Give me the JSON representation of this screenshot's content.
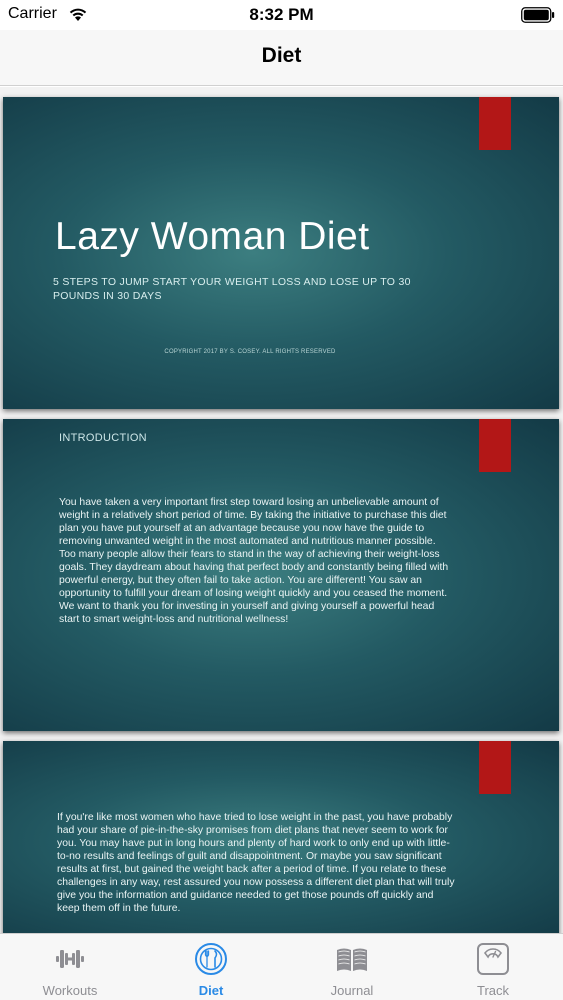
{
  "status_bar": {
    "carrier": "Carrier",
    "time": "8:32 PM"
  },
  "nav": {
    "title": "Diet"
  },
  "slides": [
    {
      "title": "Lazy Woman Diet",
      "subtitle": "5 STEPS TO JUMP START YOUR WEIGHT LOSS AND LOSE UP TO 30 POUNDS IN 30 DAYS",
      "copyright": "COPYRIGHT 2017 BY S. COSEY. ALL RIGHTS RESERVED"
    },
    {
      "heading": "INTRODUCTION",
      "body": "You have taken a very important first step toward losing an unbelievable amount of weight in a relatively short period of time. By taking the initiative to purchase this diet plan you have put yourself at an advantage because you now have the guide to removing unwanted weight in the most automated and nutritious manner possible. Too many people allow their fears to stand in the way of achieving their weight-loss goals. They daydream about having that perfect body and constantly being filled with powerful energy, but they often fail to take action. You are different! You saw an opportunity to fulfill your dream of losing weight quickly and you ceased the moment. We want to thank you for investing in yourself and giving yourself a powerful head start to smart weight-loss and nutritional wellness!"
    },
    {
      "body": "If you're like most women who have tried to lose weight in the past, you have probably had your share of pie-in-the-sky promises from diet plans that never seem to work for you. You may have put in long hours and plenty of hard work to only end up with little-to-no results and feelings of guilt and disappointment. Or maybe you saw significant results at first, but gained the weight back after a period of time. If you relate to these challenges in any way, rest assured you now possess a different diet plan that will truly give you the information and guidance needed to get those pounds off quickly and keep them off in the future."
    }
  ],
  "tabs": [
    {
      "label": "Workouts",
      "icon": "dumbbell-icon",
      "active": false
    },
    {
      "label": "Diet",
      "icon": "plate-utensils-icon",
      "active": true
    },
    {
      "label": "Journal",
      "icon": "book-icon",
      "active": false
    },
    {
      "label": "Track",
      "icon": "scale-icon",
      "active": false
    }
  ],
  "colors": {
    "accent": "#2a8ae6",
    "inactive": "#8e8e93",
    "slide_red": "#b31717",
    "slide_teal": "#235a63"
  }
}
